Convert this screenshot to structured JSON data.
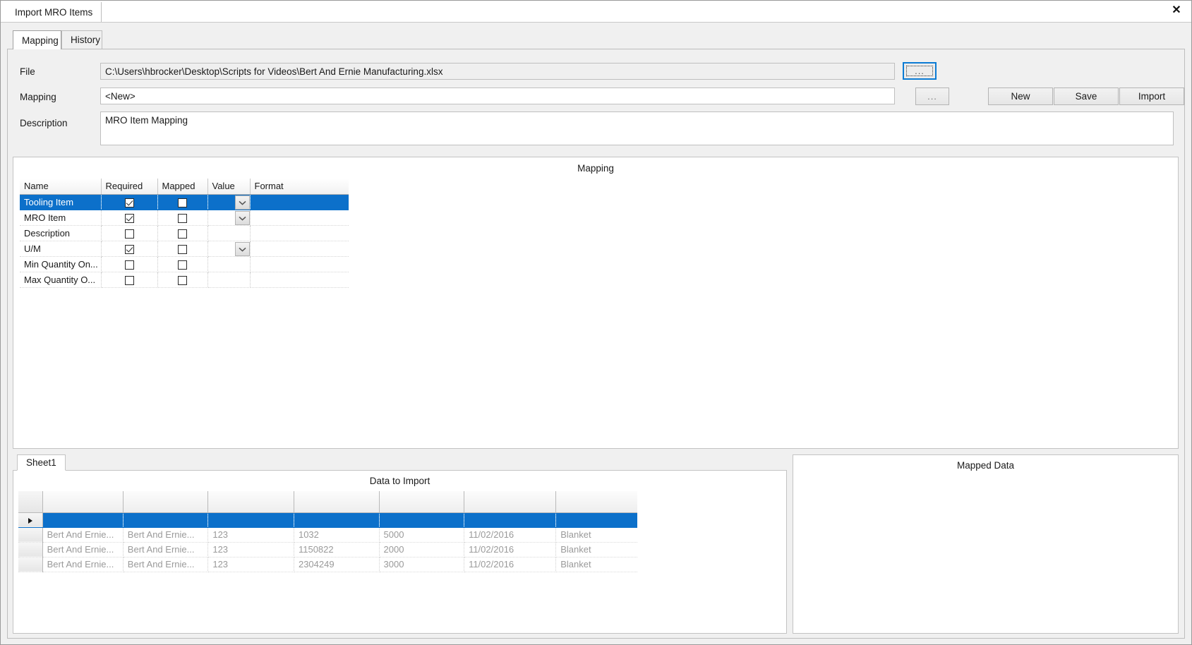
{
  "window": {
    "doc_tab_title": "Import MRO Items",
    "close_icon": "close-icon",
    "close_glyph": "✕"
  },
  "tabs": [
    {
      "label": "Mapping",
      "active": true
    },
    {
      "label": "History",
      "active": false
    }
  ],
  "form": {
    "file_label": "File",
    "file_value": "C:\\Users\\hbrocker\\Desktop\\Scripts for Videos\\Bert And Ernie Manufacturing.xlsx",
    "mapping_label": "Mapping",
    "mapping_value": "<New>",
    "description_label": "Description",
    "description_value": "MRO Item Mapping",
    "browse_file_label": "...",
    "browse_mapping_label": "...",
    "new_label": "New",
    "save_label": "Save",
    "import_label": "Import"
  },
  "mapping_panel": {
    "caption": "Mapping",
    "columns": [
      "Name",
      "Required",
      "Mapped",
      "Value",
      "Format"
    ],
    "rows": [
      {
        "name": "Tooling Item",
        "required": true,
        "mapped": false,
        "has_dropdown": true,
        "value": "",
        "format": "",
        "selected": true
      },
      {
        "name": "MRO Item",
        "required": true,
        "mapped": false,
        "has_dropdown": true,
        "value": "",
        "format": "",
        "selected": false
      },
      {
        "name": "Description",
        "required": false,
        "mapped": false,
        "has_dropdown": false,
        "value": "",
        "format": "",
        "selected": false
      },
      {
        "name": "U/M",
        "required": true,
        "mapped": false,
        "has_dropdown": true,
        "value": "",
        "format": "",
        "selected": false
      },
      {
        "name": "Min Quantity On...",
        "required": false,
        "mapped": false,
        "has_dropdown": false,
        "value": "",
        "format": "",
        "selected": false
      },
      {
        "name": "Max Quantity O...",
        "required": false,
        "mapped": false,
        "has_dropdown": false,
        "value": "",
        "format": "",
        "selected": false
      }
    ]
  },
  "data_panel": {
    "sheet_tab": "Sheet1",
    "caption": "Data to Import",
    "selected_row_marker": "▶",
    "rows": [
      {
        "cells": [
          "",
          "",
          "",
          "",
          "",
          "",
          ""
        ],
        "selected": true
      },
      {
        "cells": [
          "Bert And Ernie...",
          "Bert And Ernie...",
          "123",
          "1032",
          "5000",
          "11/02/2016",
          "Blanket"
        ],
        "selected": false
      },
      {
        "cells": [
          "Bert And Ernie...",
          "Bert And Ernie...",
          "123",
          "1150822",
          "2000",
          "11/02/2016",
          "Blanket"
        ],
        "selected": false
      },
      {
        "cells": [
          "Bert And Ernie...",
          "Bert And Ernie...",
          "123",
          "2304249",
          "3000",
          "11/02/2016",
          "Blanket"
        ],
        "selected": false
      }
    ]
  },
  "mapped_panel": {
    "caption": "Mapped Data"
  },
  "colors": {
    "selection_blue": "#0c70ca",
    "focus_blue": "#0b7bd4",
    "window_bg": "#f0f0f0",
    "panel_bg": "#ffffff",
    "muted_text": "#9a9a9a"
  }
}
